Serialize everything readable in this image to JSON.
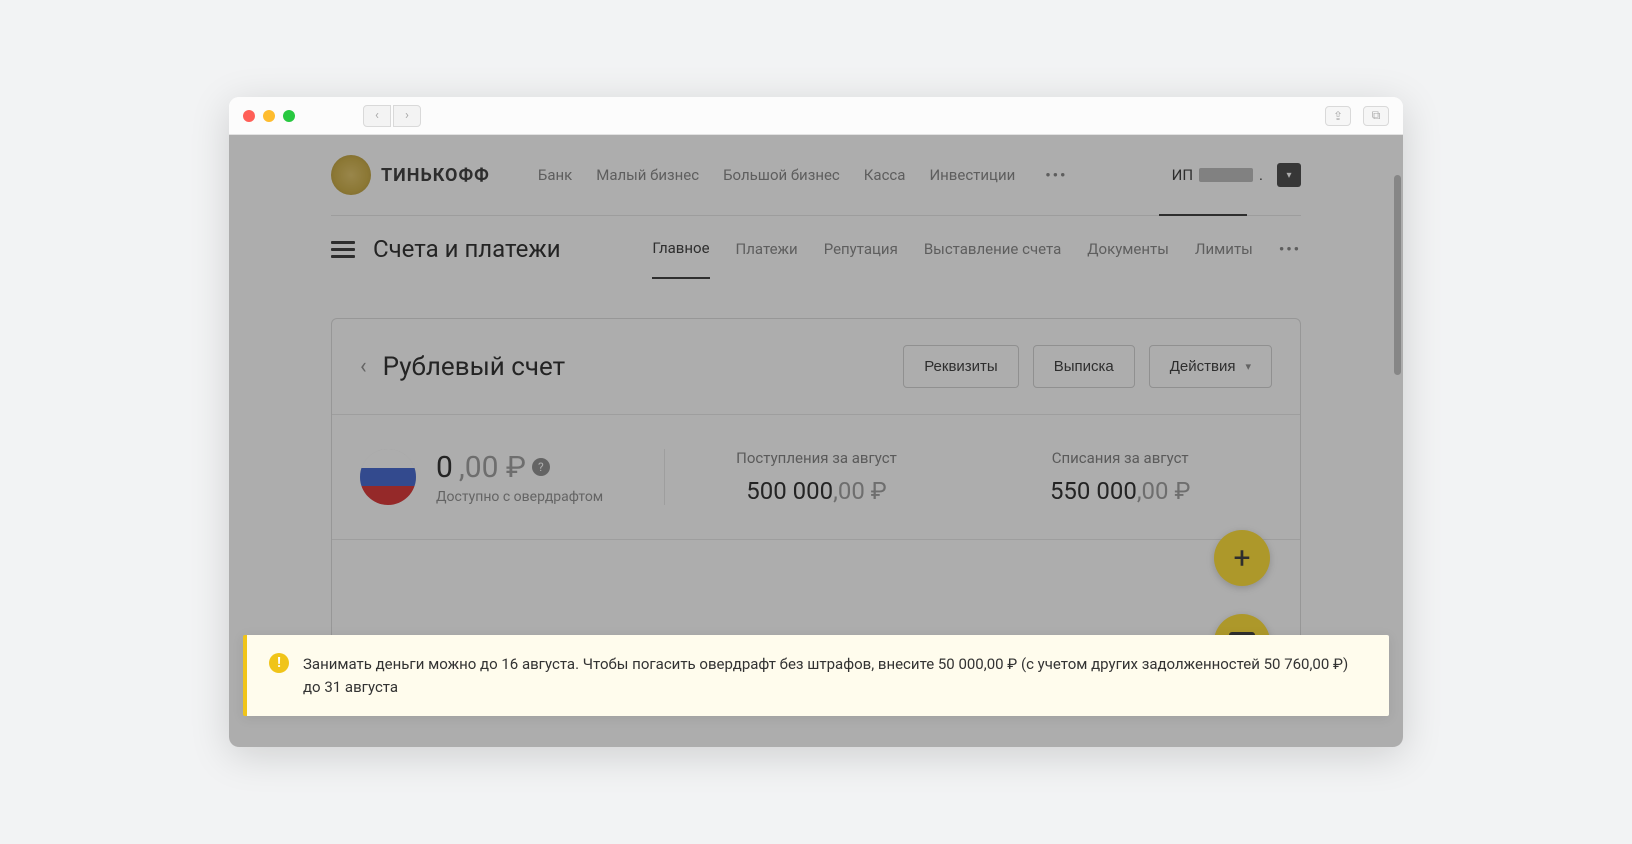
{
  "brand": "ТИНЬКОФФ",
  "topNav": {
    "items": [
      "Банк",
      "Малый бизнес",
      "Большой бизнес",
      "Касса",
      "Инвестиции"
    ],
    "more": "•••"
  },
  "user": {
    "prefix": "ИП",
    "suffix": "."
  },
  "section": {
    "title": "Счета и платежи",
    "tabs": [
      "Главное",
      "Платежи",
      "Репутация",
      "Выставление счета",
      "Документы",
      "Лимиты"
    ],
    "more": "•••",
    "activeTab": 0
  },
  "account": {
    "title": "Рублевый счет",
    "actions": {
      "requisites": "Реквизиты",
      "statement": "Выписка",
      "more": "Действия"
    }
  },
  "balance": {
    "amountMain": "0",
    "amountRest": ",00 ₽",
    "subtitle": "Доступно с овердрафтом"
  },
  "stats": {
    "incoming": {
      "label": "Поступления за август",
      "main": "500 000",
      "rest": ",00 ₽"
    },
    "outgoing": {
      "label": "Списания за август",
      "main": "550 000",
      "rest": ",00 ₽"
    }
  },
  "alert": {
    "text": "Занимать деньги можно до 16 августа. Чтобы погасить овердрафт без штрафов, внесите 50 000,00 ₽ (с учетом других задолженностей 50 760,00 ₽) до 31 августа"
  }
}
